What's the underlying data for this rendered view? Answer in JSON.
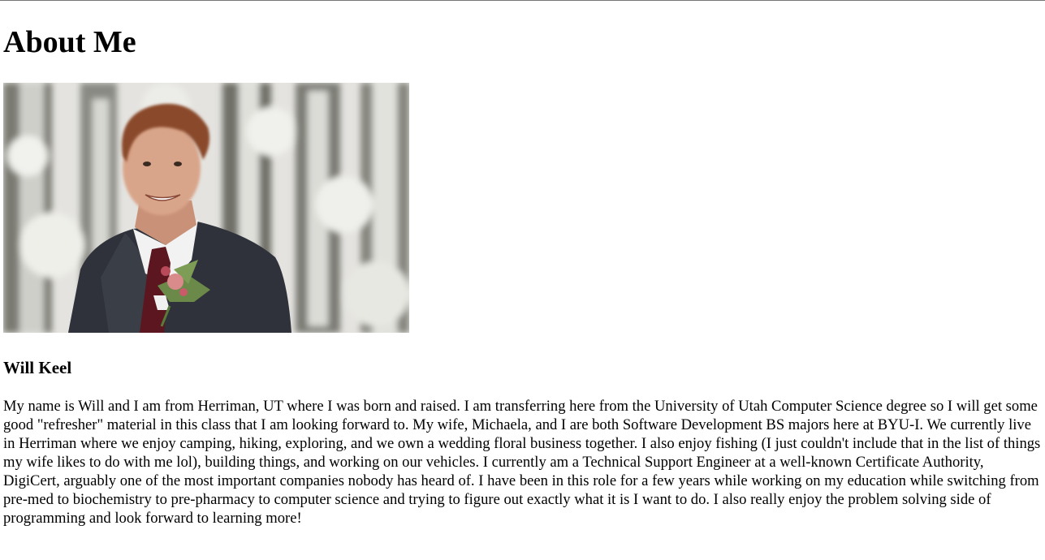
{
  "page": {
    "heading": "About Me",
    "photo": {
      "alt": "Portrait of Will Keel in a suit with a boutonniere in front of snowy trees",
      "colors": {
        "snow": "#e8e8e6",
        "trees": "#5a5a55",
        "suit": "#2f323a",
        "tie": "#5b1620",
        "shirt": "#f2f2f2",
        "skin": "#d9a58a",
        "hair": "#8a4a2a",
        "flower_green": "#6b8a4a",
        "flower_pink": "#d98a8a"
      }
    },
    "name": "Will Keel",
    "bio": "My name is Will and I am from Herriman, UT where I was born and raised. I am transferring here from the University of Utah Computer Science degree so I will get some good \"refresher\" material in this class that I am looking forward to. My wife, Michaela, and I are both Software Development BS majors here at BYU-I. We currently live in Herriman where we enjoy camping, hiking, exploring, and we own a wedding floral business together. I also enjoy fishing (I just couldn't include that in the list of things my wife likes to do with me lol), building things, and working on our vehicles. I currently am a Technical Support Engineer at a well-known Certificate Authority, DigiCert, arguably one of the most important companies nobody has heard of. I have been in this role for a few years while working on my education while switching from pre-med to biochemistry to pre-pharmacy to computer science and trying to figure out exactly what it is I want to do. I also really enjoy the problem solving side of programming and look forward to learning more!"
  }
}
